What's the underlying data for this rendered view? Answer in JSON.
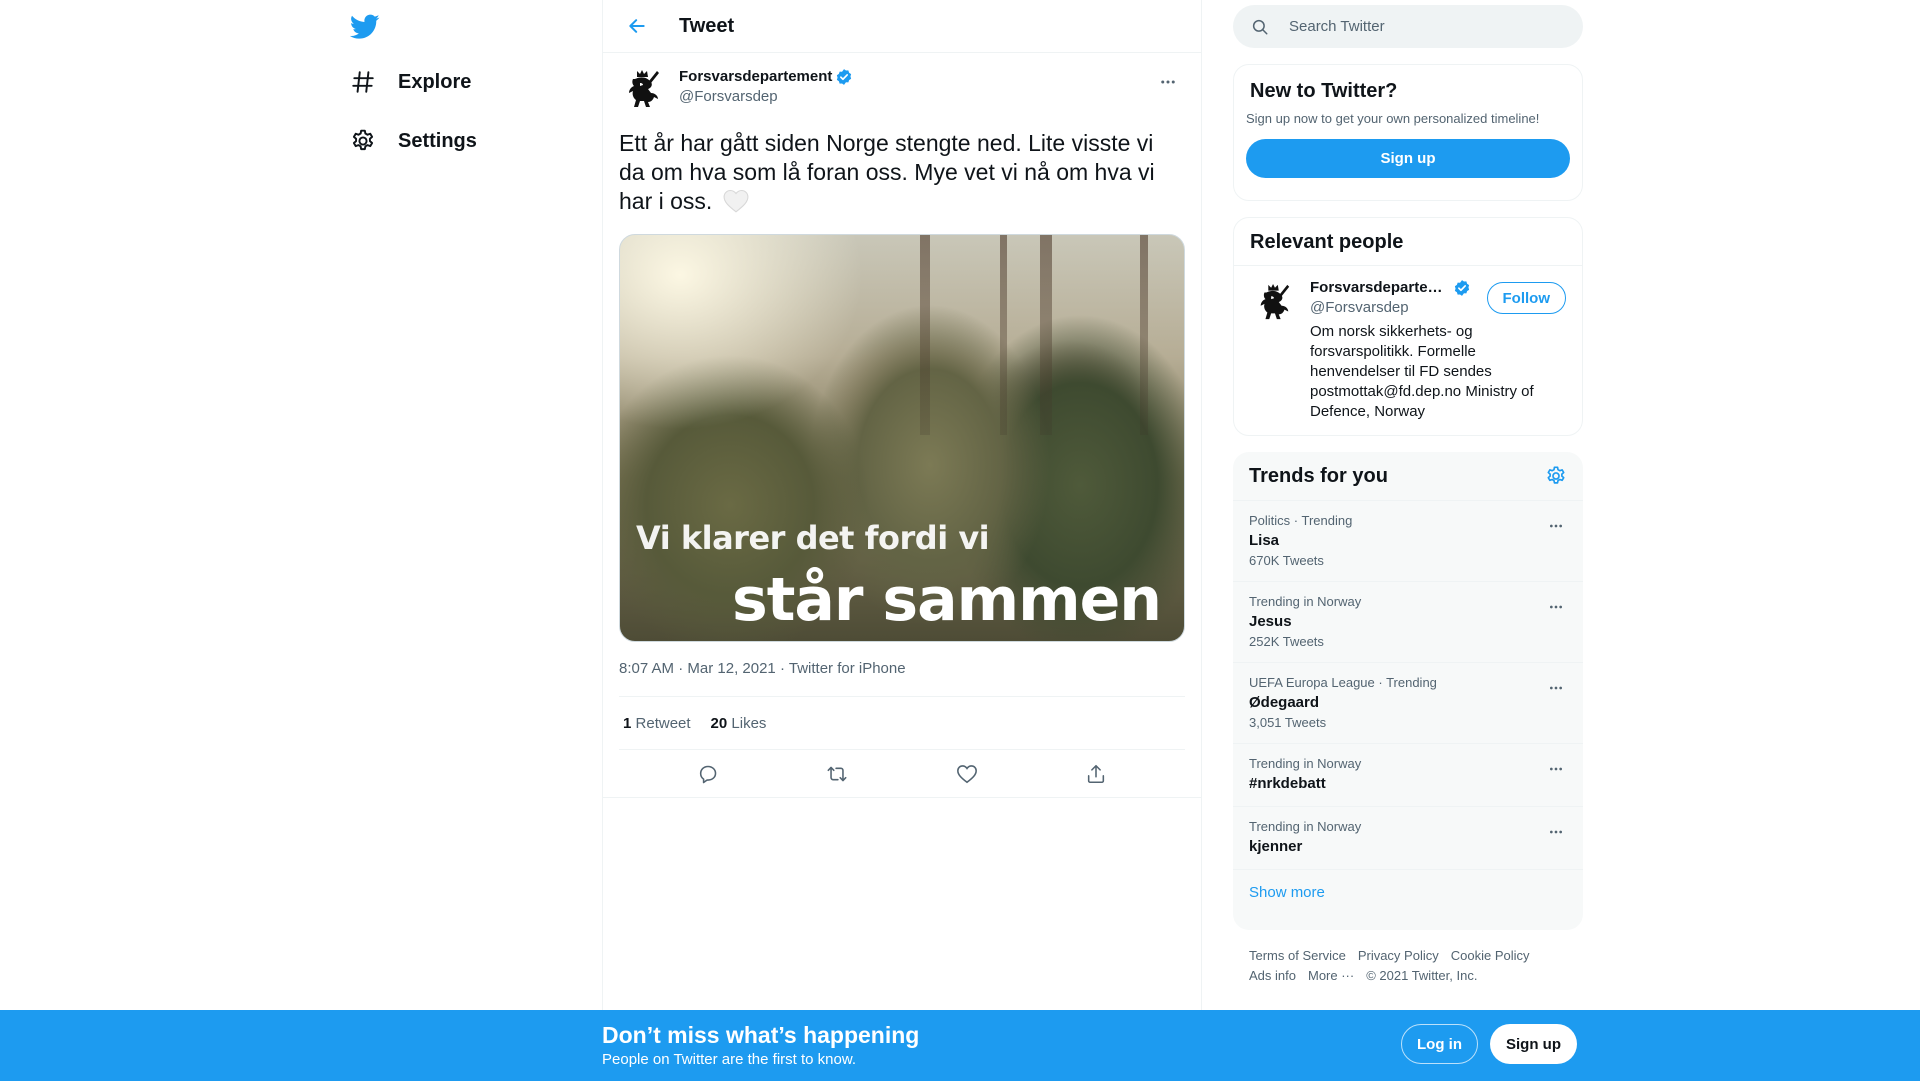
{
  "colors": {
    "accent": "#1d9bf0",
    "text": "#0f1419",
    "secondary_text": "#536471",
    "border": "#eff3f4"
  },
  "nav": {
    "logo_icon": "twitter-bird-icon",
    "items": [
      {
        "label": "Explore",
        "icon": "hashtag-icon"
      },
      {
        "label": "Settings",
        "icon": "gear-icon"
      }
    ]
  },
  "header": {
    "title": "Tweet",
    "back_icon": "arrow-left-icon"
  },
  "tweet": {
    "author_name": "Forsvarsdepartement",
    "author_handle": "@Forsvarsdep",
    "verified": true,
    "text": "Ett år har gått siden Norge stengte ned. Lite visste vi da om hva som lå foran oss. Mye vet vi nå om hva vi har i oss.",
    "text_emoji": "white-heart-emoji",
    "image_caption_line1": "Vi klarer det fordi vi",
    "image_caption_line2": "står sammen",
    "time": "8:07 AM",
    "date": "Mar 12, 2021",
    "source": "Twitter for iPhone",
    "retweets_count": "1",
    "retweets_label": "Retweet",
    "likes_count": "20",
    "likes_label": "Likes",
    "actions": [
      "reply-icon",
      "retweet-icon",
      "like-icon",
      "share-icon"
    ]
  },
  "search": {
    "placeholder": "Search Twitter"
  },
  "new_to_twitter": {
    "title": "New to Twitter?",
    "subtitle": "Sign up now to get your own personalized timeline!",
    "button": "Sign up"
  },
  "relevant_people": {
    "title": "Relevant people",
    "person": {
      "name": "Forsvarsdeparte…",
      "handle": "@Forsvarsdep",
      "bio": "Om norsk sikkerhets- og forsvarspolitikk. Formelle henvendelser til FD sendes postmottak@fd.dep.no Ministry of Defence, Norway",
      "follow": "Follow"
    }
  },
  "trends": {
    "title": "Trends for you",
    "items": [
      {
        "context": "Politics · Trending",
        "name": "Lisa",
        "count": "670K Tweets"
      },
      {
        "context": "Trending in Norway",
        "name": "Jesus",
        "count": "252K Tweets"
      },
      {
        "context": "UEFA Europa League · Trending",
        "name": "Ødegaard",
        "count": "3,051 Tweets"
      },
      {
        "context": "Trending in Norway",
        "name": "#nrkdebatt",
        "count": ""
      },
      {
        "context": "Trending in Norway",
        "name": "kjenner",
        "count": ""
      }
    ],
    "show_more": "Show more"
  },
  "footer": {
    "links": [
      "Terms of Service",
      "Privacy Policy",
      "Cookie Policy",
      "Ads info",
      "More ···"
    ],
    "copyright": "© 2021 Twitter, Inc."
  },
  "banner": {
    "headline": "Don’t miss what’s happening",
    "subtitle": "People on Twitter are the first to know.",
    "login": "Log in",
    "signup": "Sign up"
  }
}
